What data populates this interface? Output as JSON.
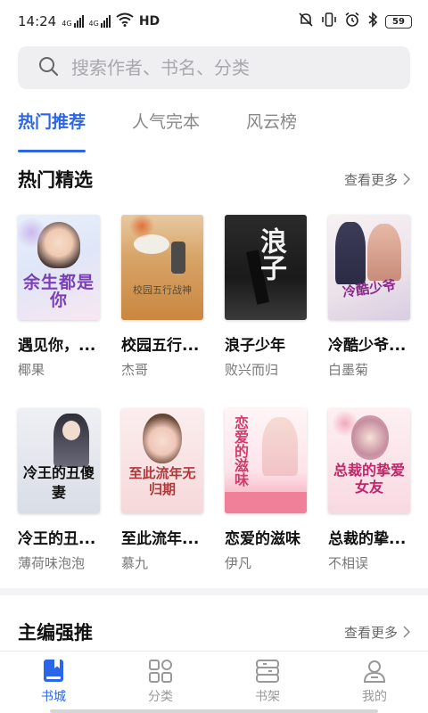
{
  "status": {
    "time": "14:24",
    "net1": "4G",
    "net2": "4G",
    "hd": "HD",
    "battery": "59"
  },
  "search": {
    "placeholder": "搜索作者、书名、分类"
  },
  "tabs": [
    {
      "label": "热门推荐",
      "active": true
    },
    {
      "label": "人气完本",
      "active": false
    },
    {
      "label": "风云榜",
      "active": false
    }
  ],
  "section1": {
    "title": "热门精选",
    "more": "查看更多"
  },
  "books": [
    {
      "title": "遇见你，...",
      "author": "椰果",
      "cover_text": "余生都是你"
    },
    {
      "title": "校园五行...",
      "author": "杰哥",
      "cover_text": "校园五行战神"
    },
    {
      "title": "浪子少年",
      "author": "败兴而归",
      "cover_text": "浪子"
    },
    {
      "title": "冷酷少爷...",
      "author": "白墨菊",
      "cover_text": "冷酷少爷"
    },
    {
      "title": "冷王的丑...",
      "author": "薄荷味泡泡",
      "cover_text": "冷王的丑傻妻"
    },
    {
      "title": "至此流年...",
      "author": "慕九",
      "cover_text": "至此流年无归期"
    },
    {
      "title": "恋爱的滋味",
      "author": "伊凡",
      "cover_text": "恋爱的滋味"
    },
    {
      "title": "总裁的挚...",
      "author": "不相误",
      "cover_text": "总裁的挚爱女友"
    }
  ],
  "section2": {
    "title": "主编强推",
    "more": "查看更多"
  },
  "nav": [
    {
      "label": "书城",
      "icon": "book-icon",
      "active": true
    },
    {
      "label": "分类",
      "icon": "grid-icon",
      "active": false
    },
    {
      "label": "书架",
      "icon": "shelf-icon",
      "active": false
    },
    {
      "label": "我的",
      "icon": "user-icon",
      "active": false
    }
  ],
  "colors": {
    "accent": "#2b66e8"
  }
}
